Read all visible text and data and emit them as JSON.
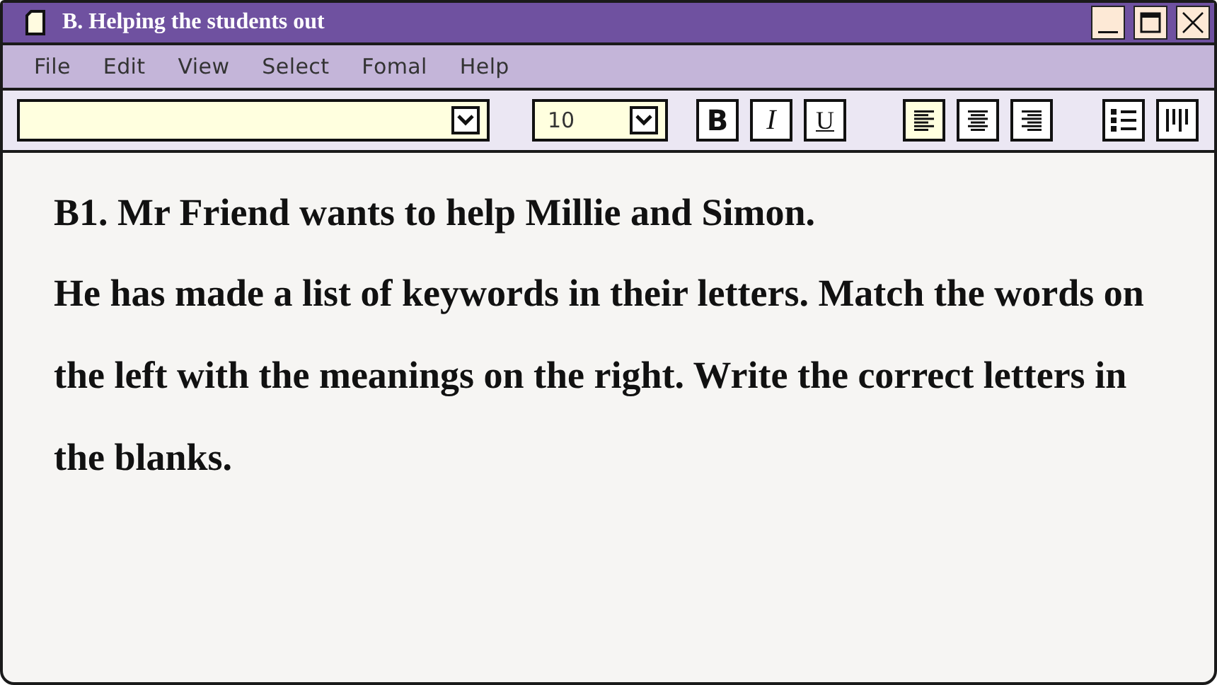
{
  "window": {
    "title": "B. Helping the students out"
  },
  "menu": [
    "File",
    "Edit",
    "View",
    "Select",
    "Fomal",
    "Help"
  ],
  "toolbar": {
    "font_size": "10",
    "format_buttons": [
      {
        "label": "B",
        "kind": "bold"
      },
      {
        "label": "I",
        "kind": "italic"
      },
      {
        "label": "U",
        "kind": "underline"
      }
    ],
    "align_buttons": [
      {
        "kind": "left",
        "selected": true
      },
      {
        "kind": "center",
        "selected": false
      },
      {
        "kind": "right",
        "selected": false
      }
    ],
    "list_buttons": [
      {
        "kind": "bullets"
      },
      {
        "kind": "columns"
      }
    ]
  },
  "document": {
    "heading": "B1. Mr Friend wants to help Millie and Simon.",
    "paragraph": "He has made a list of keywords in their letters. Match the words on the left with the meanings on the right. Write the correct letters in the blanks."
  }
}
